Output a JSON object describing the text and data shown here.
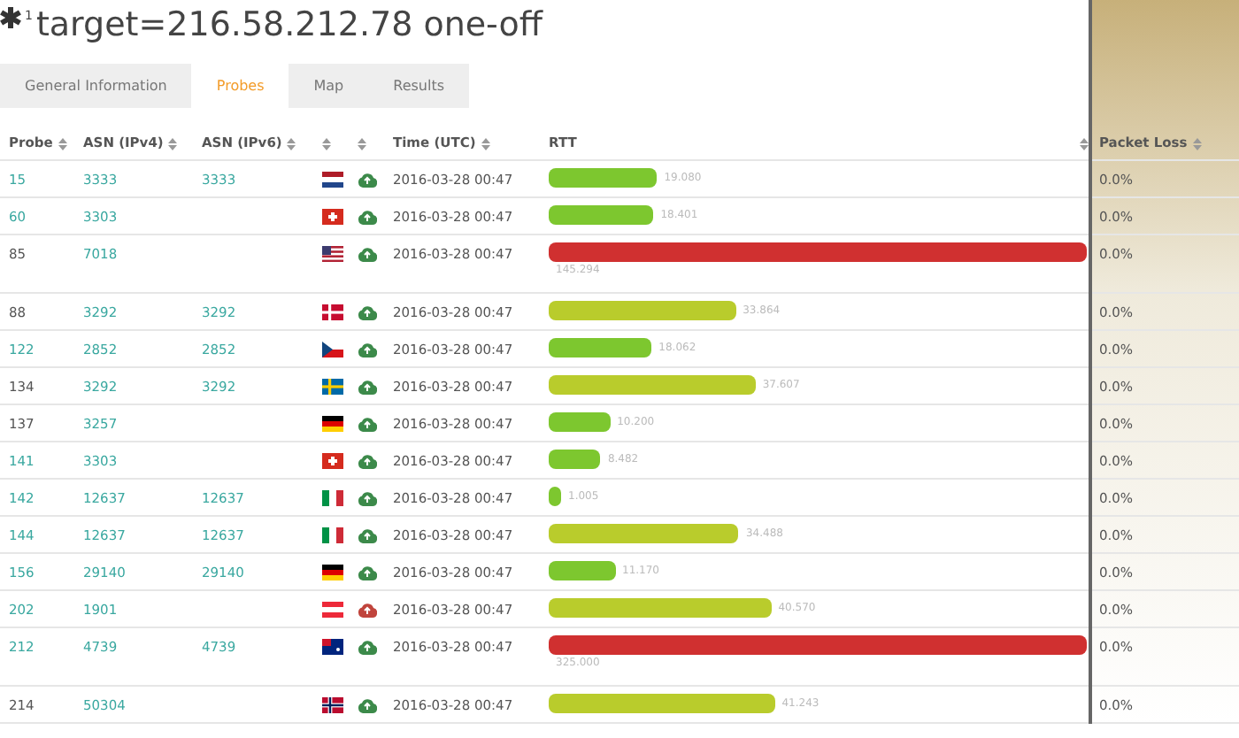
{
  "title": {
    "mark": "1",
    "text": "target=216.58.212.78 one-off"
  },
  "tabs": [
    {
      "label": "General Information",
      "selected": false
    },
    {
      "label": "Probes",
      "selected": true
    },
    {
      "label": "Map",
      "selected": false
    },
    {
      "label": "Results",
      "selected": false
    }
  ],
  "table": {
    "columns": [
      {
        "label": "Probe"
      },
      {
        "label": "ASN (IPv4)"
      },
      {
        "label": "ASN (IPv6)"
      },
      {},
      {},
      {
        "label": "Time (UTC)"
      },
      {
        "label": "RTT"
      },
      {
        "label": "Packet Loss"
      }
    ],
    "rows": [
      {
        "probe": "15",
        "linked": true,
        "asn4": "3333",
        "asn6": "3333",
        "kind": "nl",
        "online": true,
        "time": "2016-03-28 00:47",
        "rtt": "19.080",
        "color": "#7dc72f",
        "loss": "0.0%"
      },
      {
        "probe": "60",
        "linked": true,
        "asn4": "3303",
        "kind": "ch",
        "online": true,
        "time": "2016-03-28 00:47",
        "rtt": "18.401",
        "color": "#7dc72f",
        "loss": "0.0%"
      },
      {
        "probe": "85",
        "linked": false,
        "asn4": "7018",
        "kind": "us",
        "online": true,
        "time": "2016-03-28 00:47",
        "rtt": "145.294",
        "color": "#d03030",
        "loss": "0.0%"
      },
      {
        "probe": "88",
        "linked": false,
        "asn4": "3292",
        "asn6": "3292",
        "kind": "dk",
        "online": true,
        "time": "2016-03-28 00:47",
        "rtt": "33.864",
        "color": "#b9cc2c",
        "loss": "0.0%"
      },
      {
        "probe": "122",
        "linked": true,
        "asn4": "2852",
        "asn6": "2852",
        "kind": "cz",
        "online": true,
        "time": "2016-03-28 00:47",
        "rtt": "18.062",
        "color": "#7dc72f",
        "loss": "0.0%"
      },
      {
        "probe": "134",
        "linked": false,
        "asn4": "3292",
        "asn6": "3292",
        "kind": "se",
        "online": true,
        "time": "2016-03-28 00:47",
        "rtt": "37.607",
        "color": "#b9cc2c",
        "loss": "0.0%"
      },
      {
        "probe": "137",
        "linked": false,
        "asn4": "3257",
        "kind": "de",
        "online": true,
        "time": "2016-03-28 00:47",
        "rtt": "10.200",
        "color": "#7dc72f",
        "loss": "0.0%"
      },
      {
        "probe": "141",
        "linked": true,
        "asn4": "3303",
        "kind": "ch",
        "online": true,
        "time": "2016-03-28 00:47",
        "rtt": "8.482",
        "color": "#7dc72f",
        "loss": "0.0%"
      },
      {
        "probe": "142",
        "linked": true,
        "asn4": "12637",
        "asn6": "12637",
        "kind": "it",
        "online": true,
        "time": "2016-03-28 00:47",
        "rtt": "1.005",
        "color": "#7dc72f",
        "loss": "0.0%"
      },
      {
        "probe": "144",
        "linked": true,
        "asn4": "12637",
        "asn6": "12637",
        "kind": "it",
        "online": true,
        "time": "2016-03-28 00:47",
        "rtt": "34.488",
        "color": "#b9cc2c",
        "loss": "0.0%"
      },
      {
        "probe": "156",
        "linked": true,
        "asn4": "29140",
        "asn6": "29140",
        "kind": "de",
        "online": true,
        "time": "2016-03-28 00:47",
        "rtt": "11.170",
        "color": "#7dc72f",
        "loss": "0.0%"
      },
      {
        "probe": "202",
        "linked": true,
        "asn4": "1901",
        "kind": "at",
        "online": false,
        "time": "2016-03-28 00:47",
        "rtt": "40.570",
        "color": "#b9cc2c",
        "loss": "0.0%"
      },
      {
        "probe": "212",
        "linked": true,
        "asn4": "4739",
        "asn6": "4739",
        "kind": "au",
        "online": true,
        "time": "2016-03-28 00:47",
        "rtt": "325.000",
        "color": "#d03030",
        "loss": "0.0%"
      },
      {
        "probe": "214",
        "linked": false,
        "asn4": "50304",
        "kind": "no",
        "online": true,
        "time": "2016-03-28 00:47",
        "rtt": "41.243",
        "color": "#b9cc2c",
        "loss": "0.0%"
      }
    ]
  }
}
